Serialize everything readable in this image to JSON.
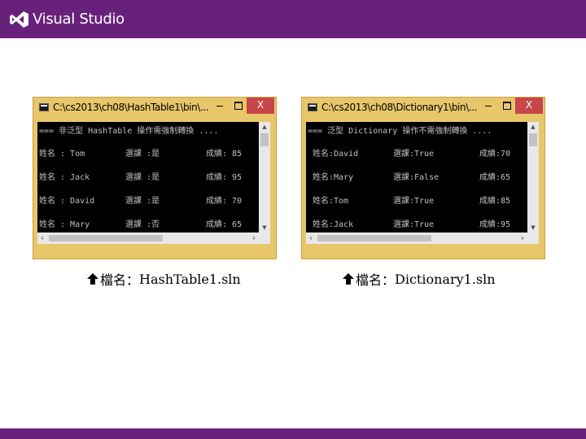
{
  "header": {
    "brand": "Visual Studio",
    "bar_color": "#68217a"
  },
  "windows": [
    {
      "title": "C:\\cs2013\\ch08\\HashTable1\\bin\\...",
      "close_label": "X",
      "header_line": "=== 非泛型 HashTable 操作需強制轉換 ....",
      "rows": [
        {
          "name": "姓名 : Tom",
          "choice": "選課 :是",
          "score": "成績: 85"
        },
        {
          "name": "姓名 : Jack",
          "choice": "選課 :是",
          "score": "成績: 95"
        },
        {
          "name": "姓名 : David",
          "choice": "選課 :是",
          "score": "成績: 70"
        },
        {
          "name": "姓名 : Mary",
          "choice": "選課 :否",
          "score": "成績: 65"
        }
      ]
    },
    {
      "title": "C:\\cs2013\\ch08\\Dictionary1\\bin\\...",
      "close_label": "X",
      "header_line": "=== 泛型 Dictionary 操作不需強制轉換 ....",
      "rows": [
        {
          "name": "姓名:David",
          "choice": "選課:True",
          "score": "成績:70"
        },
        {
          "name": "姓名:Mary",
          "choice": "選課:False",
          "score": "成績:65"
        },
        {
          "name": "姓名:Tom",
          "choice": "選課:True",
          "score": "成績:85"
        },
        {
          "name": "姓名:Jack",
          "choice": "選課:True",
          "score": "成績:95"
        }
      ]
    }
  ],
  "captions": [
    {
      "label": "檔名：",
      "file": "HashTable1.sln"
    },
    {
      "label": "檔名：",
      "file": "Dictionary1.sln"
    }
  ],
  "icons": {
    "logo": "visual-studio-logo",
    "caption_marker": "arrow-up-icon",
    "console": "console-icon"
  }
}
